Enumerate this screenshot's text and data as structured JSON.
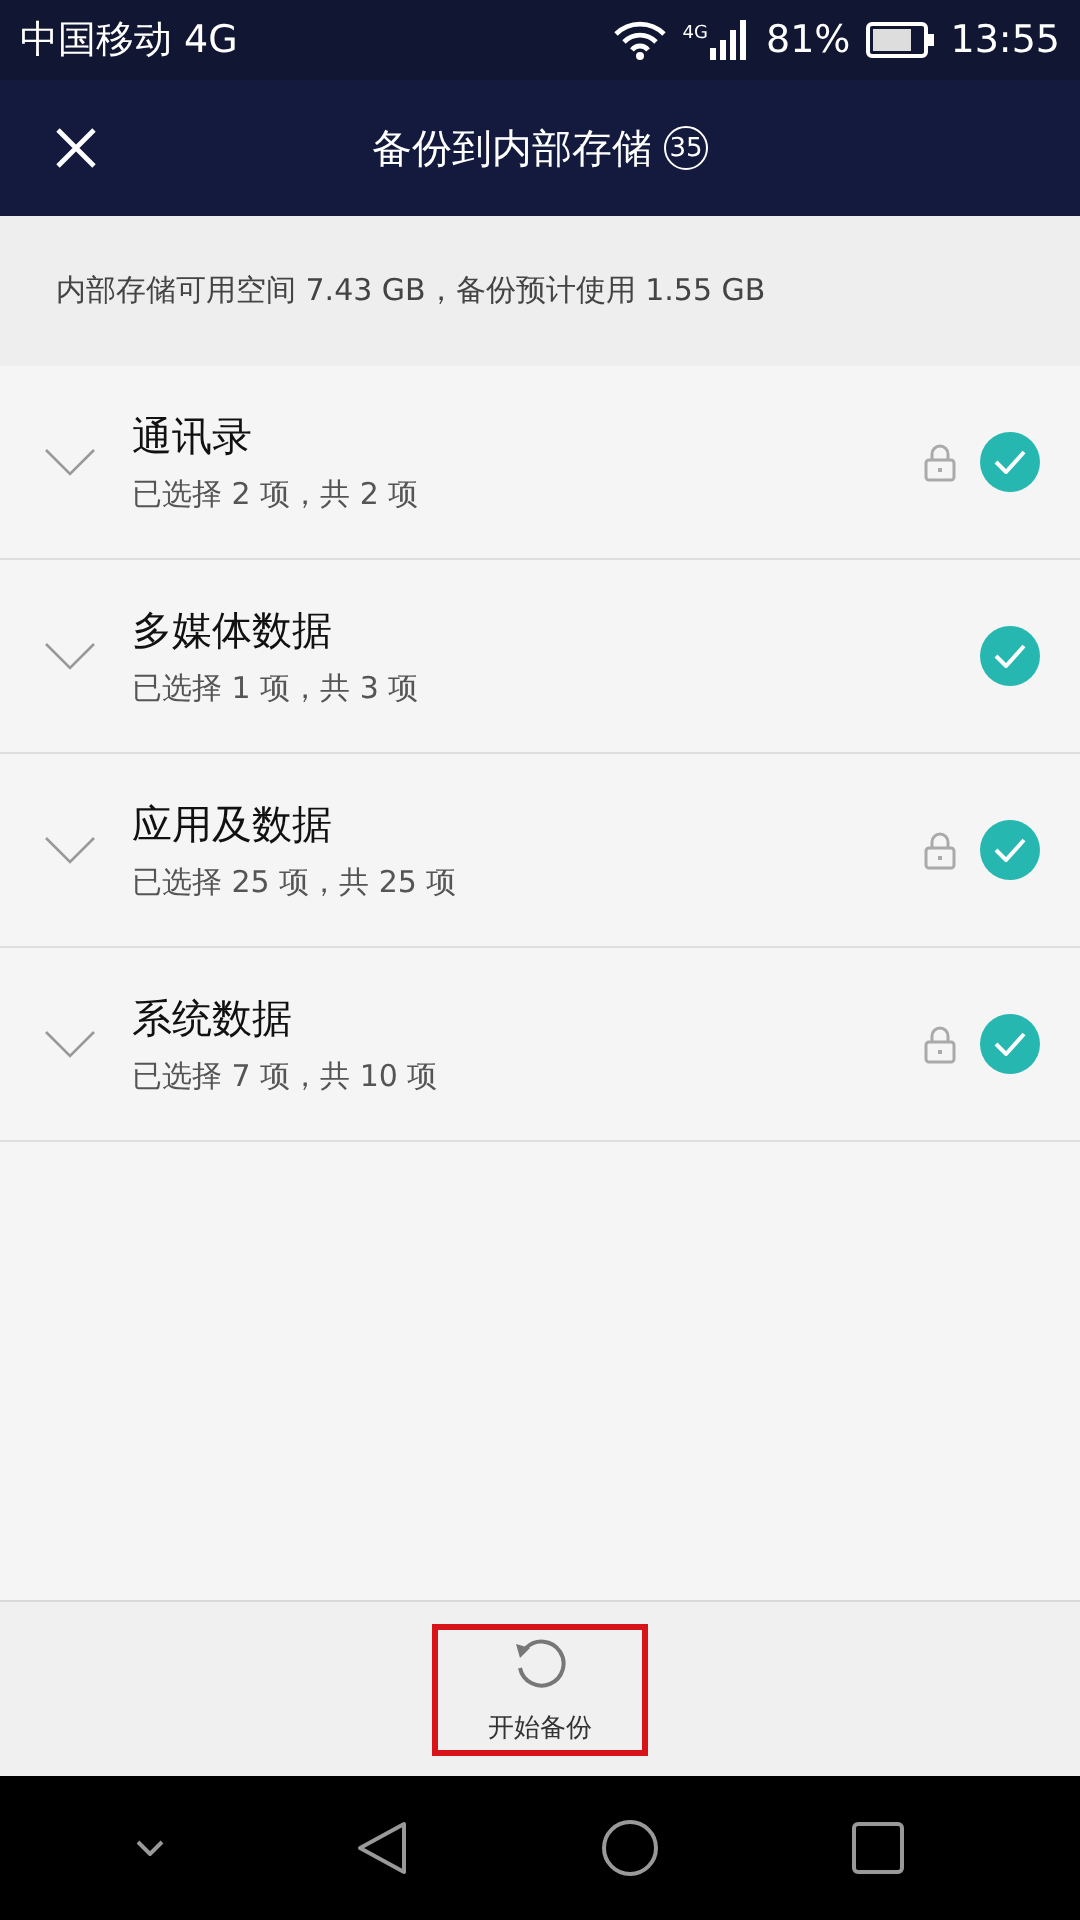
{
  "status_bar": {
    "carrier": "中国移动 4G",
    "network": "4G",
    "battery": "81%",
    "time": "13:55"
  },
  "title_bar": {
    "title": "备份到内部存储",
    "count": "35"
  },
  "storage_info": "内部存储可用空间 7.43 GB，备份预计使用 1.55 GB",
  "categories": [
    {
      "name": "通讯录",
      "summary": "已选择 2 项，共 2 项",
      "locked": true,
      "checked": true
    },
    {
      "name": "多媒体数据",
      "summary": "已选择 1 项，共 3 项",
      "locked": false,
      "checked": true
    },
    {
      "name": "应用及数据",
      "summary": "已选择 25 项，共 25 项",
      "locked": true,
      "checked": true
    },
    {
      "name": "系统数据",
      "summary": "已选择 7 项，共 10 项",
      "locked": true,
      "checked": true
    }
  ],
  "action": {
    "label": "开始备份",
    "highlighted": true
  }
}
